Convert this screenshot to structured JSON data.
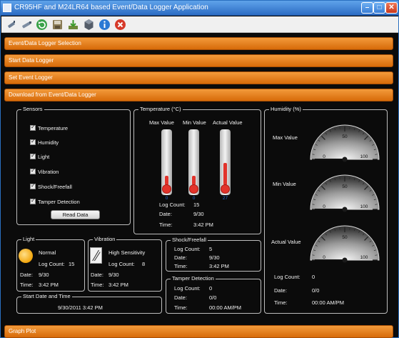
{
  "window": {
    "title": "CR95HF and M24LR64 based Event/Data Logger Application"
  },
  "toolbar": {
    "icons": [
      "plug-icon",
      "usb-icon",
      "refresh-icon",
      "save-icon",
      "download-icon",
      "settings-icon",
      "info-icon",
      "exit-icon"
    ]
  },
  "accordion": {
    "selection": "Event/Data Logger Selection",
    "start": "Start Data Logger",
    "set": "Set Event Logger",
    "download": "Download from Event/Data Logger",
    "graph": "Graph Plot"
  },
  "sensors": {
    "title": "Sensors",
    "items": [
      "Temperature",
      "Humidity",
      "Light",
      "Vibration",
      "Shock/Freefall",
      "Tamper Detection"
    ],
    "read_button": "Read Data"
  },
  "temperature": {
    "title": "Temperature (°C)",
    "headers": [
      "Max Value",
      "Min Value",
      "Actual Value"
    ],
    "values": [
      "0",
      "0",
      "27"
    ],
    "levels": [
      0.18,
      0.18,
      0.42
    ],
    "log_label": "Log Count:",
    "log_value": "15",
    "date_label": "Date:",
    "date_value": "9/30",
    "time_label": "Time:",
    "time_value": "3:42 PM"
  },
  "humidity": {
    "title": "Humidity (%)",
    "gauges": [
      {
        "label": "Max Value",
        "value": 0
      },
      {
        "label": "Min Value",
        "value": 0
      },
      {
        "label": "Actual Value",
        "value": 0
      }
    ],
    "scale": [
      "0",
      "50",
      "100"
    ],
    "log_label": "Log Count:",
    "log_value": "0",
    "date_label": "Date:",
    "date_value": "0/0",
    "time_label": "Time:",
    "time_value": "00:00 AM/PM"
  },
  "light": {
    "title": "Light",
    "status": "Normal",
    "log_label": "Log Count:",
    "log_value": "15",
    "date_label": "Date:",
    "date_value": "9/30",
    "time_label": "Time:",
    "time_value": "3:42 PM"
  },
  "vibration": {
    "title": "Vibration",
    "status": "High Sensitivity",
    "log_label": "Log Count:",
    "log_value": "8",
    "date_label": "Date:",
    "date_value": "9/30",
    "time_label": "Time:",
    "time_value": "3:42 PM"
  },
  "shock": {
    "title": "Shock/Freefall",
    "log_label": "Log Count:",
    "log_value": "5",
    "date_label": "Date:",
    "date_value": "9/30",
    "time_label": "Time:",
    "time_value": "3:42 PM"
  },
  "tamper": {
    "title": "Tamper Detection",
    "log_label": "Log Count:",
    "log_value": "0",
    "date_label": "Date:",
    "date_value": "0/0",
    "time_label": "Time:",
    "time_value": "00:00 AM/PM"
  },
  "start": {
    "title": "Start Date and Time",
    "value": "9/30/2011  3:42 PM"
  },
  "colors": {
    "accent": "#e07a12",
    "thermo_fill": "#e2332b",
    "value_blue": "#2c6fd8"
  }
}
